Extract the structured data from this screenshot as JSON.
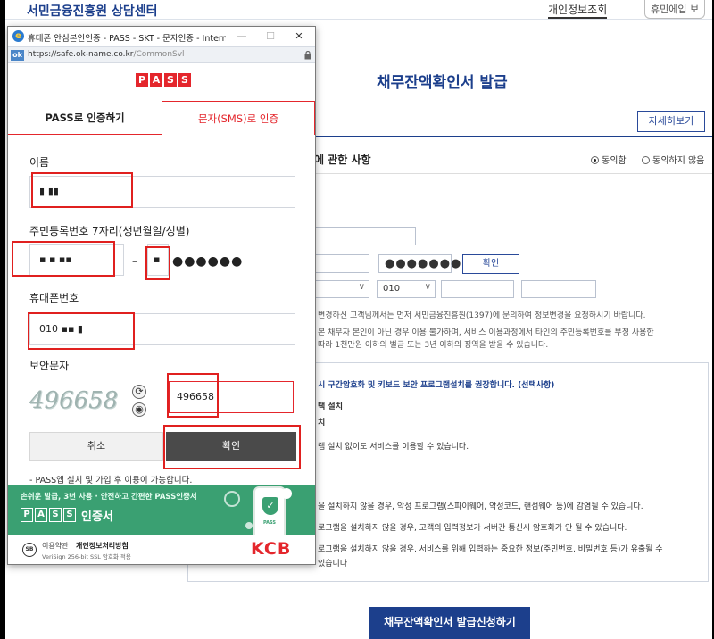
{
  "site": {
    "logo": "서민금융진흥원 상담센터",
    "login": "개인정보조회",
    "join": "휴민에입 보",
    "title": "채무잔액확인서 발급",
    "detail_button": "자세히보기",
    "agree_heading": "에 관한 사항",
    "agree": "동의함",
    "disagree": "동의하지 않음",
    "masked_pin": "●●●●●●●",
    "confirm_button": "확인",
    "phone_prefix": "010",
    "notices": [
      "변경하신 고객님께서는 먼저 서민금융진흥원(1397)에 문의하여 정보변경을 요청하시기 바랍니다.",
      "본 채무자 본인이 아닌 경우 이용 불가하며, 서비스 이용과정에서 타인의 주민등록번호를 부정 사용한",
      "따라 1천만원 이하의 벌금 또는 3년 이하의 징역을 받을 수 있습니다."
    ],
    "security_title": "시 구간암호화 및 키보드 보안 프로그램설치를 권장합니다. (선택사항)",
    "options": [
      "택 설치",
      "치",
      "램 설치 없이도 서비스를 이용할 수 있습니다.",
      "을 설치하지 않을 경우, 악성 프로그램(스파이웨어, 악성코드, 랜섬웨어 등)에 감염될 수 있습니다.",
      "로그램을 설치하지 않을 경우, 고객의 입력정보가 서버간 통신시 암호화가 안 될 수 있습니다.",
      "로그램을 설치하지 않을 경우, 서비스를 위해 입력하는 중요한 정보(주민번호, 비밀번호 등)가 유출될 수",
      "있습니다"
    ],
    "apply_button": "채무잔액확인서 발급신청하기"
  },
  "popup": {
    "window_title": "휴대폰 안심본인인증 - PASS - SKT - 문자인증 - Internet...",
    "win_min": "—",
    "win_max": "☐",
    "win_close": "✕",
    "favicon": "ok",
    "url_host": "https://safe.ok-name.co.kr",
    "url_path": "/CommonSvl",
    "logo_letters": [
      "P",
      "A",
      "S",
      "S"
    ],
    "tabs": {
      "pass": "PASS로 인증하기",
      "sms": "문자(SMS)로 인증"
    },
    "labels": {
      "name": "이름",
      "rrn": "주민등록번호 7자리(생년월일/성별)",
      "phone": "휴대폰번호",
      "security": "보안문자"
    },
    "values": {
      "name": "▮ ▮▮",
      "rrn_front": "▪ ▪ ▪▪",
      "rrn_gender": "▪",
      "rrn_masked": "●●●●●●",
      "rrn_dash": "–",
      "phone": "010  ▪▪ ▮",
      "captcha": "496658",
      "security_input": "496658"
    },
    "captcha_refresh_icon": "⟳",
    "captcha_audio_icon": "◉",
    "buttons": {
      "cancel": "취소",
      "confirm": "확인"
    },
    "note": "- PASS앱 설치 및 가입 후 이용이 가능합니다.",
    "banner": {
      "small": "손쉬운 발급, 3년 사용 · 안전하고 간편한 PASS인증서",
      "pass_letters": [
        "P",
        "A",
        "S",
        "S"
      ],
      "cert": "인증서",
      "phone_label": "PASS",
      "shield_check": "✓"
    },
    "footer": {
      "seal": "SB",
      "terms": "이용약관",
      "privacy": "개인정보처리방침",
      "verisign": "VeriSign 256-bit SSL 암호화 적용",
      "brand": "KCB"
    }
  },
  "colors": {
    "pass_red": "#e4262c",
    "site_blue": "#1c3f8c",
    "banner_green": "#3aa072"
  }
}
